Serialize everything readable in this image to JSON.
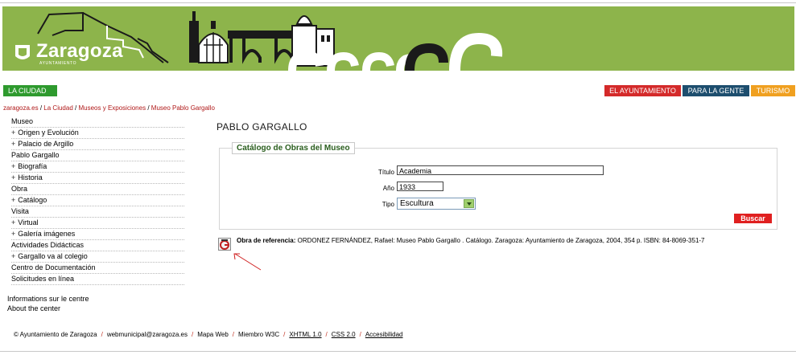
{
  "header": {
    "logo_text": "Zaragoza",
    "logo_sub": "AYUNTAMIENTO"
  },
  "nav": {
    "la_ciudad": "LA CIUDAD",
    "el_ayuntamiento": "EL AYUNTAMIENTO",
    "para_la_gente": "PARA LA GENTE",
    "turismo": "TURISMO"
  },
  "breadcrumb": {
    "items": [
      "zaragoza.es",
      "La Ciudad",
      "Museos y Exposiciones",
      "Museo Pablo Gargallo"
    ],
    "separator": "/"
  },
  "sidebar": {
    "items": [
      {
        "label": "Museo",
        "sub": false
      },
      {
        "label": "Origen y Evolución",
        "sub": true
      },
      {
        "label": "Palacio de Argillo",
        "sub": true
      },
      {
        "label": "Pablo Gargallo",
        "sub": false
      },
      {
        "label": "Biografía",
        "sub": true
      },
      {
        "label": "Historia",
        "sub": true
      },
      {
        "label": "Obra",
        "sub": false
      },
      {
        "label": "Catálogo",
        "sub": true
      },
      {
        "label": "Visita",
        "sub": false
      },
      {
        "label": "Virtual",
        "sub": true
      },
      {
        "label": "Galería imágenes",
        "sub": true
      },
      {
        "label": "Actividades Didácticas",
        "sub": false
      },
      {
        "label": "Gargallo va al colegio",
        "sub": true
      },
      {
        "label": "Centro de Documentación",
        "sub": false
      },
      {
        "label": "Solicitudes en línea",
        "sub": false
      }
    ],
    "plus": "+",
    "lang_fr": "Informations sur le centre",
    "lang_en": "About the center"
  },
  "main": {
    "page_title": "PABLO GARGALLO",
    "panel_title": "Catálogo de Obras del Museo",
    "form": {
      "titulo_label": "Título",
      "titulo_value": "Academia",
      "anio_label": "Año",
      "anio_value": "1933",
      "tipo_label": "Tipo",
      "tipo_value": "Escultura",
      "buscar_label": "Buscar"
    },
    "reference": {
      "label": "Obra de referencia:",
      "text": "ORDONEZ FERNÁNDEZ, Rafael: Museo Pablo Gargallo . Catálogo. Zaragoza: Ayuntamiento de Zaragoza, 2004, 354 p. ISBN: 84-8069-351-7",
      "icon_letter": "G"
    }
  },
  "footer": {
    "copyright": "© Ayuntamiento de Zaragoza",
    "email": "webmunicipal@zaragoza.es",
    "mapa": "Mapa Web",
    "w3c": "Miembro W3C",
    "xhtml": "XHTML 1.0",
    "css": "CSS 2.0",
    "accesibilidad": "Accesibilidad"
  },
  "colors": {
    "banner_green": "#8db44b",
    "ciudad_green": "#2e9a2e",
    "ayto_red": "#d42a2a",
    "gente_blue": "#1d4e6e",
    "turismo_orange": "#f0a020",
    "link_red": "#b01818"
  }
}
